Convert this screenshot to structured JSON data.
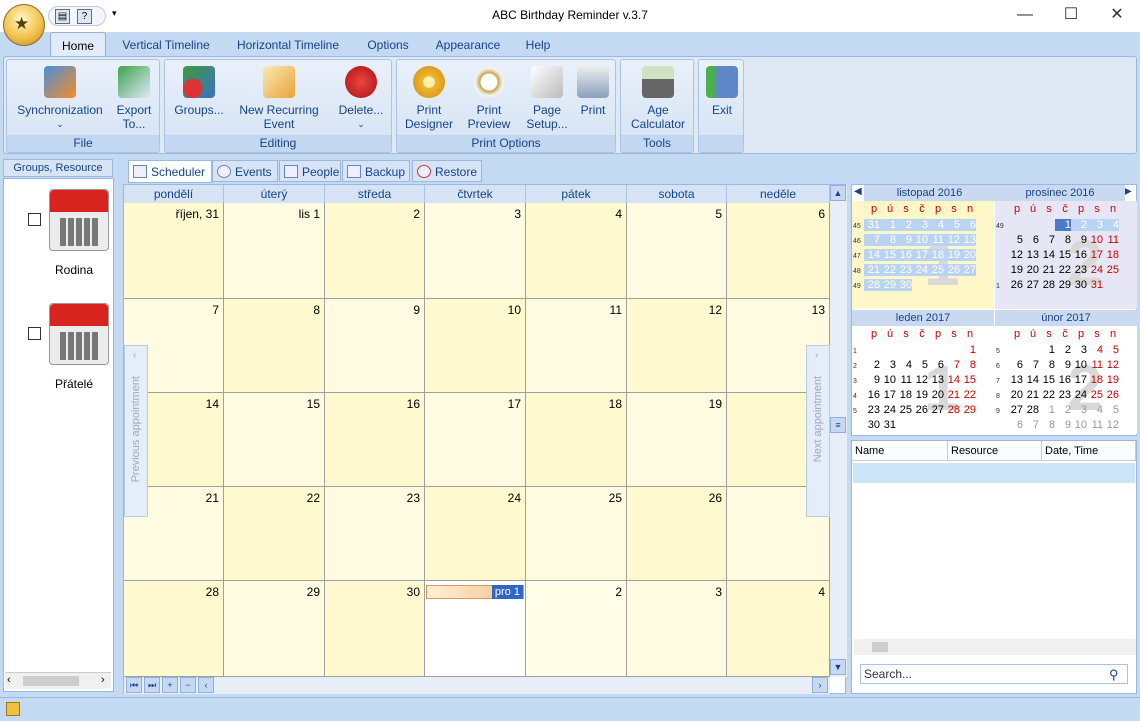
{
  "app": {
    "title": "ABC Birthday Reminder v.3.7"
  },
  "menu_tabs": [
    "Home",
    "Vertical Timeline",
    "Horizontal Timeline",
    "Options",
    "Appearance",
    "Help"
  ],
  "ribbon": {
    "file": {
      "label": "File",
      "sync": "Synchronization",
      "export": "Export To..."
    },
    "editing": {
      "label": "Editing",
      "groups": "Groups...",
      "new_recurring": "New Recurring Event",
      "delete": "Delete..."
    },
    "print": {
      "label": "Print Options",
      "designer": "Print Designer",
      "preview": "Print Preview",
      "page_setup": "Page Setup...",
      "print": "Print"
    },
    "tools": {
      "label": "Tools",
      "age_calc": "Age Calculator"
    },
    "exit": {
      "label": "Exit"
    }
  },
  "left_panel": {
    "header": "Groups, Resource",
    "resources": [
      "Rodina",
      "Přátelé"
    ]
  },
  "view_tabs": [
    "Scheduler",
    "Events",
    "People",
    "Backup",
    "Restore"
  ],
  "scheduler": {
    "days": [
      "pondělí",
      "úterý",
      "středa",
      "čtvrtek",
      "pátek",
      "sobota",
      "neděle"
    ],
    "weeks": [
      [
        "říjen, 31",
        "lis 1",
        "2",
        "3",
        "4",
        "5",
        "6"
      ],
      [
        "7",
        "8",
        "9",
        "10",
        "11",
        "12",
        "13"
      ],
      [
        "14",
        "15",
        "16",
        "17",
        "18",
        "19",
        ""
      ],
      [
        "21",
        "22",
        "23",
        "24",
        "25",
        "26",
        ""
      ],
      [
        "28",
        "29",
        "30",
        "",
        "2",
        "3",
        "4"
      ]
    ],
    "appointment_label": "pro 1",
    "prev_label": "Previous appointment",
    "next_label": "Next appointment"
  },
  "mini_calendars": {
    "weekday_letters": [
      "p",
      "ú",
      "s",
      "č",
      "p",
      "s",
      "n"
    ],
    "months": [
      {
        "title": "listopad 2016",
        "big": "1",
        "weeks": [
          "45",
          "46",
          "47",
          "48",
          "49"
        ],
        "rows": [
          [
            "31",
            "1",
            "2",
            "3",
            "4",
            "5",
            "6"
          ],
          [
            "7",
            "8",
            "9",
            "10",
            "11",
            "12",
            "13"
          ],
          [
            "14",
            "15",
            "16",
            "17",
            "18",
            "19",
            "20"
          ],
          [
            "21",
            "22",
            "23",
            "24",
            "25",
            "26",
            "27"
          ],
          [
            "28",
            "29",
            "30",
            "",
            "",
            "",
            ""
          ]
        ]
      },
      {
        "title": "prosinec 2016",
        "big": "2",
        "weeks": [
          "49",
          "",
          "",
          "",
          "1"
        ],
        "rows": [
          [
            "",
            "",
            "",
            "1",
            "2",
            "3",
            "4"
          ],
          [
            "5",
            "6",
            "7",
            "8",
            "9",
            "10",
            "11"
          ],
          [
            "12",
            "13",
            "14",
            "15",
            "16",
            "17",
            "18"
          ],
          [
            "19",
            "20",
            "21",
            "22",
            "23",
            "24",
            "25"
          ],
          [
            "26",
            "27",
            "28",
            "29",
            "30",
            "31",
            ""
          ]
        ]
      },
      {
        "title": "leden 2017",
        "big": "1",
        "weeks": [
          "1",
          "2",
          "3",
          "4",
          "5"
        ],
        "rows": [
          [
            "",
            "",
            "",
            "",
            "",
            "",
            "1"
          ],
          [
            "2",
            "3",
            "4",
            "5",
            "6",
            "7",
            "8"
          ],
          [
            "9",
            "10",
            "11",
            "12",
            "13",
            "14",
            "15"
          ],
          [
            "16",
            "17",
            "18",
            "19",
            "20",
            "21",
            "22"
          ],
          [
            "23",
            "24",
            "25",
            "26",
            "27",
            "28",
            "29"
          ],
          [
            "30",
            "31",
            "",
            "",
            "",
            "",
            ""
          ]
        ]
      },
      {
        "title": "únor 2017",
        "big": "2",
        "weeks": [
          "5",
          "6",
          "7",
          "8",
          "9"
        ],
        "rows": [
          [
            "",
            "",
            "1",
            "2",
            "3",
            "4",
            "5"
          ],
          [
            "6",
            "7",
            "8",
            "9",
            "10",
            "11",
            "12"
          ],
          [
            "13",
            "14",
            "15",
            "16",
            "17",
            "18",
            "19"
          ],
          [
            "20",
            "21",
            "22",
            "23",
            "24",
            "25",
            "26"
          ],
          [
            "27",
            "28",
            "1",
            "2",
            "3",
            "4",
            "5"
          ],
          [
            "6",
            "7",
            "8",
            "9",
            "10",
            "11",
            "12"
          ]
        ]
      }
    ]
  },
  "event_list": {
    "columns": [
      "Name",
      "Resource",
      "Date, Time"
    ],
    "search_placeholder": "Search..."
  }
}
